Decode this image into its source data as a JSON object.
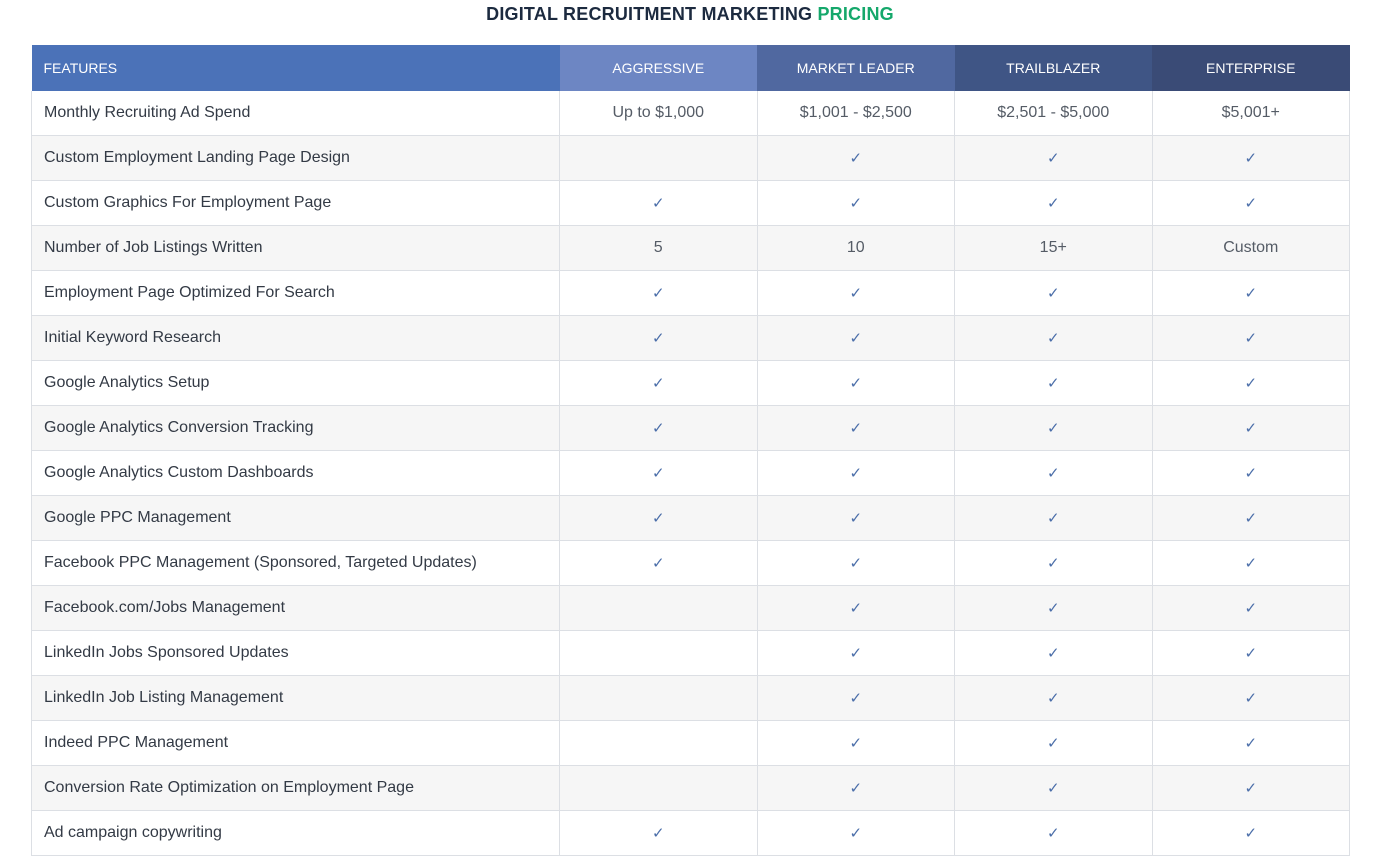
{
  "title": {
    "main": "DIGITAL RECRUITMENT MARKETING ",
    "accent": "PRICING"
  },
  "colors": {
    "accent": "#15a86b",
    "check": "#4b6ea9",
    "header_features": "#4b72b8"
  },
  "check_icon": "checkmark-icon",
  "table": {
    "headers": [
      "FEATURES",
      "AGGRESSIVE",
      "MARKET LEADER",
      "TRAILBLAZER",
      "ENTERPRISE"
    ],
    "rows": [
      {
        "feature": "Monthly Recruiting Ad Spend",
        "cells": [
          "Up to $1,000",
          "$1,001 - $2,500",
          "$2,501 - $5,000",
          "$5,001+"
        ]
      },
      {
        "feature": "Custom Employment Landing Page Design",
        "cells": [
          "",
          "✓",
          "✓",
          "✓"
        ]
      },
      {
        "feature": "Custom Graphics For Employment Page",
        "cells": [
          "✓",
          "✓",
          "✓",
          "✓"
        ]
      },
      {
        "feature": "Number of Job Listings Written",
        "cells": [
          "5",
          "10",
          "15+",
          "Custom"
        ]
      },
      {
        "feature": "Employment Page Optimized For Search",
        "cells": [
          "✓",
          "✓",
          "✓",
          "✓"
        ]
      },
      {
        "feature": "Initial Keyword Research",
        "cells": [
          "✓",
          "✓",
          "✓",
          "✓"
        ]
      },
      {
        "feature": "Google Analytics Setup",
        "cells": [
          "✓",
          "✓",
          "✓",
          "✓"
        ]
      },
      {
        "feature": "Google Analytics Conversion Tracking",
        "cells": [
          "✓",
          "✓",
          "✓",
          "✓"
        ]
      },
      {
        "feature": "Google Analytics Custom Dashboards",
        "cells": [
          "✓",
          "✓",
          "✓",
          "✓"
        ]
      },
      {
        "feature": "Google PPC Management",
        "cells": [
          "✓",
          "✓",
          "✓",
          "✓"
        ]
      },
      {
        "feature": "Facebook PPC Management (Sponsored, Targeted Updates)",
        "cells": [
          "✓",
          "✓",
          "✓",
          "✓"
        ]
      },
      {
        "feature": "Facebook.com/Jobs Management",
        "cells": [
          "",
          "✓",
          "✓",
          "✓"
        ]
      },
      {
        "feature": "LinkedIn Jobs Sponsored Updates",
        "cells": [
          "",
          "✓",
          "✓",
          "✓"
        ]
      },
      {
        "feature": "LinkedIn Job Listing Management",
        "cells": [
          "",
          "✓",
          "✓",
          "✓"
        ]
      },
      {
        "feature": "Indeed PPC Management",
        "cells": [
          "",
          "✓",
          "✓",
          "✓"
        ]
      },
      {
        "feature": "Conversion Rate Optimization on Employment Page",
        "cells": [
          "",
          "✓",
          "✓",
          "✓"
        ]
      },
      {
        "feature": "Ad campaign copywriting",
        "cells": [
          "✓",
          "✓",
          "✓",
          "✓"
        ]
      }
    ]
  }
}
